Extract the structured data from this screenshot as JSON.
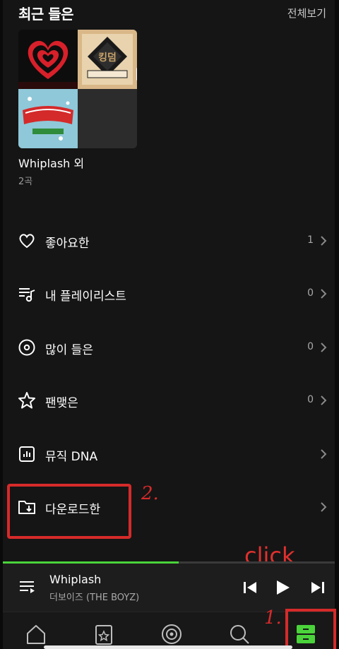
{
  "header": {
    "title": "최근 들은",
    "see_all": "전체보기"
  },
  "recent_album": {
    "title": "Whiplash 외",
    "count": "2곡"
  },
  "menu": [
    {
      "label": "좋아요한",
      "count": "1",
      "icon": "heart-icon"
    },
    {
      "label": "내 플레이리스트",
      "count": "0",
      "icon": "playlist-icon"
    },
    {
      "label": "많이 들은",
      "count": "0",
      "icon": "disc-icon"
    },
    {
      "label": "팬맺은",
      "count": "0",
      "icon": "star-icon"
    },
    {
      "label": "뮤직 DNA",
      "count": "",
      "icon": "chart-icon"
    },
    {
      "label": "다운로드한",
      "count": "",
      "icon": "download-folder-icon"
    }
  ],
  "player": {
    "title": "Whiplash",
    "artist": "더보이즈 (THE BOYZ)",
    "progress": 0.53
  },
  "annotations": {
    "step2": "2.",
    "click": "click",
    "step1": "1."
  },
  "colors": {
    "accent": "#4ad33a",
    "annotation": "#d62a2a",
    "background": "#151515"
  }
}
